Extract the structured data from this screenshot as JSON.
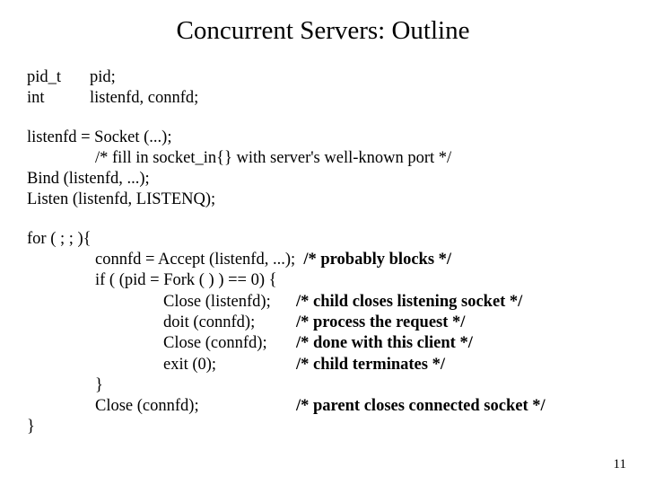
{
  "title": "Concurrent Servers: Outline",
  "decl": {
    "t1": "pid_t",
    "v1": "pid;",
    "t2": "int",
    "v2": "listenfd, connfd;"
  },
  "block1": {
    "l1": "listenfd = Socket (...);",
    "l2": "/* fill in socket_in{} with server's well-known port */",
    "l3": "Bind (listenfd, ...);",
    "l4": "Listen (listenfd, LISTENQ);"
  },
  "block2": {
    "l1": "for ( ; ; ){",
    "l2a": "connfd = Accept (listenfd, ...);  ",
    "l2b": "/* probably blocks */",
    "l3": "if ( (pid = Fork ( ) ) == 0) {",
    "l4a": "Close (listenfd);",
    "l4b": "/* child closes listening socket */",
    "l5a": "doit (connfd);",
    "l5b": "/* process the request */",
    "l6a": "Close (connfd);",
    "l6b": "/* done with this client */",
    "l7a": "exit (0);",
    "l7b": "/* child terminates */",
    "l8": "}",
    "l9a": "Close (connfd);",
    "l9b": "/* parent closes connected socket */",
    "l10": "}"
  },
  "page_number": "11"
}
